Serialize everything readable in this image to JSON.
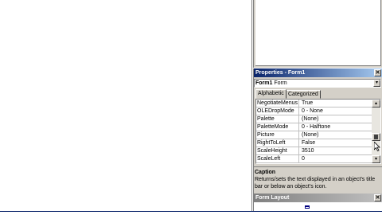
{
  "properties_window": {
    "title": "Properties - Form1",
    "close_glyph": "✕",
    "object_selector": {
      "name": "Form1",
      "type": "Form",
      "dropdown_glyph": "▾"
    },
    "tabs": [
      {
        "label": "Alphabetic",
        "active": true
      },
      {
        "label": "Categorized",
        "active": false
      }
    ],
    "rows": [
      {
        "name": "NegotiateMenus",
        "value": "True"
      },
      {
        "name": "OLEDropMode",
        "value": "0 - None"
      },
      {
        "name": "Palette",
        "value": "(None)"
      },
      {
        "name": "PaletteMode",
        "value": "0 - Halftone"
      },
      {
        "name": "Picture",
        "value": "(None)"
      },
      {
        "name": "RightToLeft",
        "value": "False"
      },
      {
        "name": "ScaleHeight",
        "value": "3510"
      },
      {
        "name": "ScaleLeft",
        "value": "0"
      }
    ],
    "scroll_up_glyph": "▴",
    "scroll_down_glyph": "▾",
    "description": {
      "title": "Caption",
      "text": "Returns/sets the text displayed in an object's title bar or below an object's icon."
    }
  },
  "form_layout_window": {
    "title": "Form Layout",
    "close_glyph": "✕"
  },
  "colors": {
    "active_title": "#0a246a",
    "inactive_title": "#808080",
    "face": "#d4d0c8"
  }
}
